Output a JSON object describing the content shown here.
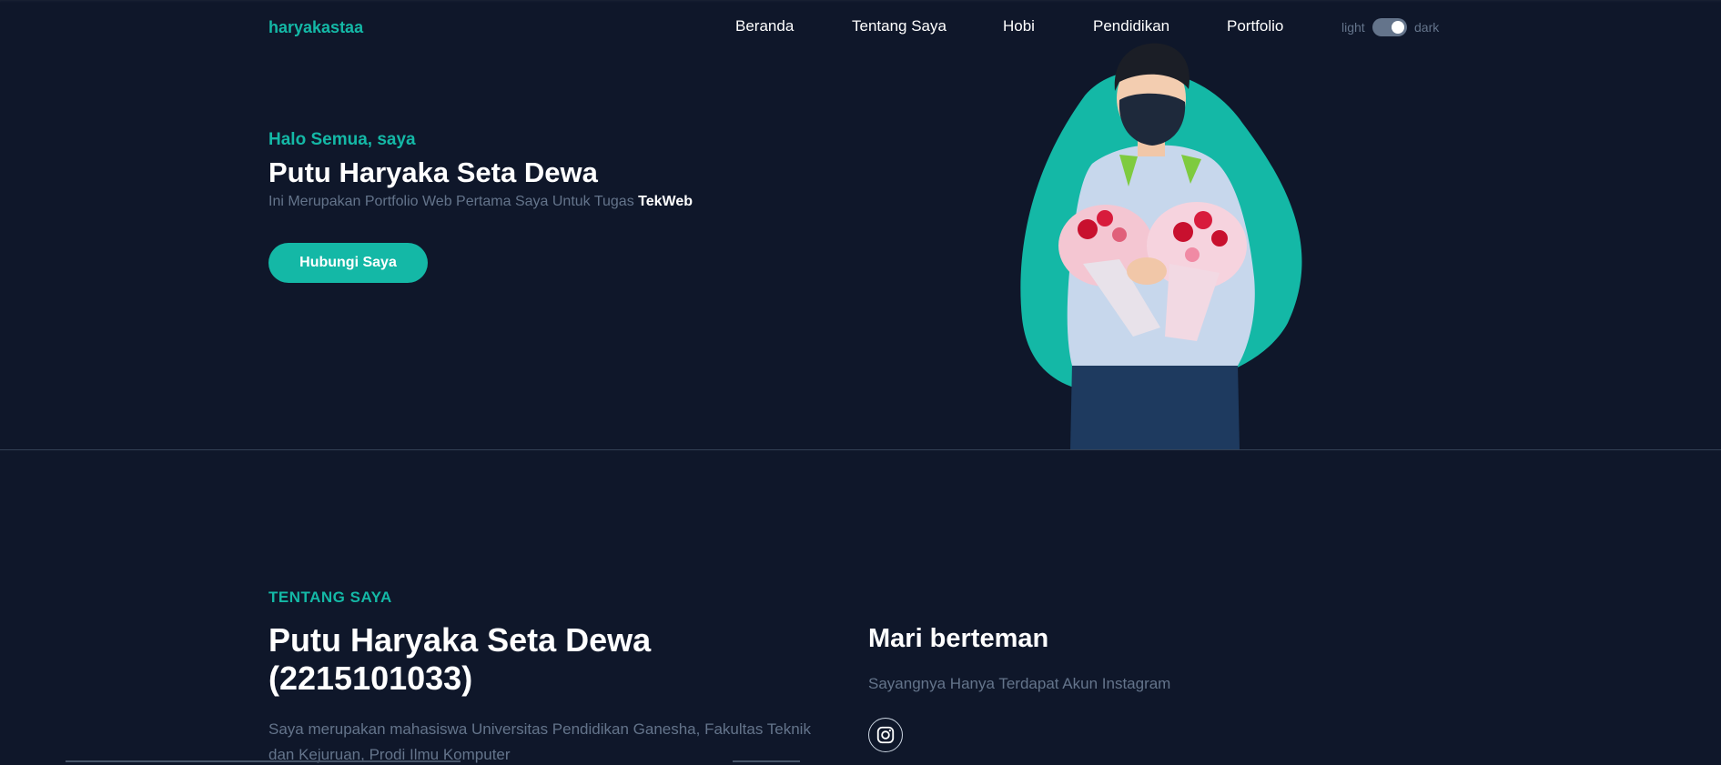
{
  "header": {
    "logo": "haryakastaa",
    "nav": [
      {
        "label": "Beranda"
      },
      {
        "label": "Tentang Saya"
      },
      {
        "label": "Hobi"
      },
      {
        "label": "Pendidikan"
      },
      {
        "label": "Portfolio"
      }
    ],
    "theme": {
      "light_label": "light",
      "dark_label": "dark",
      "dark_mode": true
    }
  },
  "hero": {
    "greeting": "Halo Semua, saya",
    "name": "Putu Haryaka Seta Dewa",
    "description": "Ini Merupakan Portfolio Web Pertama Saya Untuk Tugas",
    "description_highlight": "TekWeb",
    "button_label": "Hubungi Saya"
  },
  "about": {
    "section_label": "TENTANG SAYA",
    "title": "Putu Haryaka Seta Dewa (2215101033)",
    "text": "Saya merupakan mahasiswa Universitas Pendidikan Ganesha, Fakultas Teknik dan Kejuruan, Prodi Ilmu Komputer",
    "friends_title": "Mari berteman",
    "friends_desc": "Sayangnya Hanya Terdapat Akun Instagram",
    "social_icon": "instagram-icon"
  },
  "colors": {
    "background": "#0f172a",
    "accent": "#14b8a6",
    "muted_text": "#64748b",
    "text": "#ffffff"
  }
}
